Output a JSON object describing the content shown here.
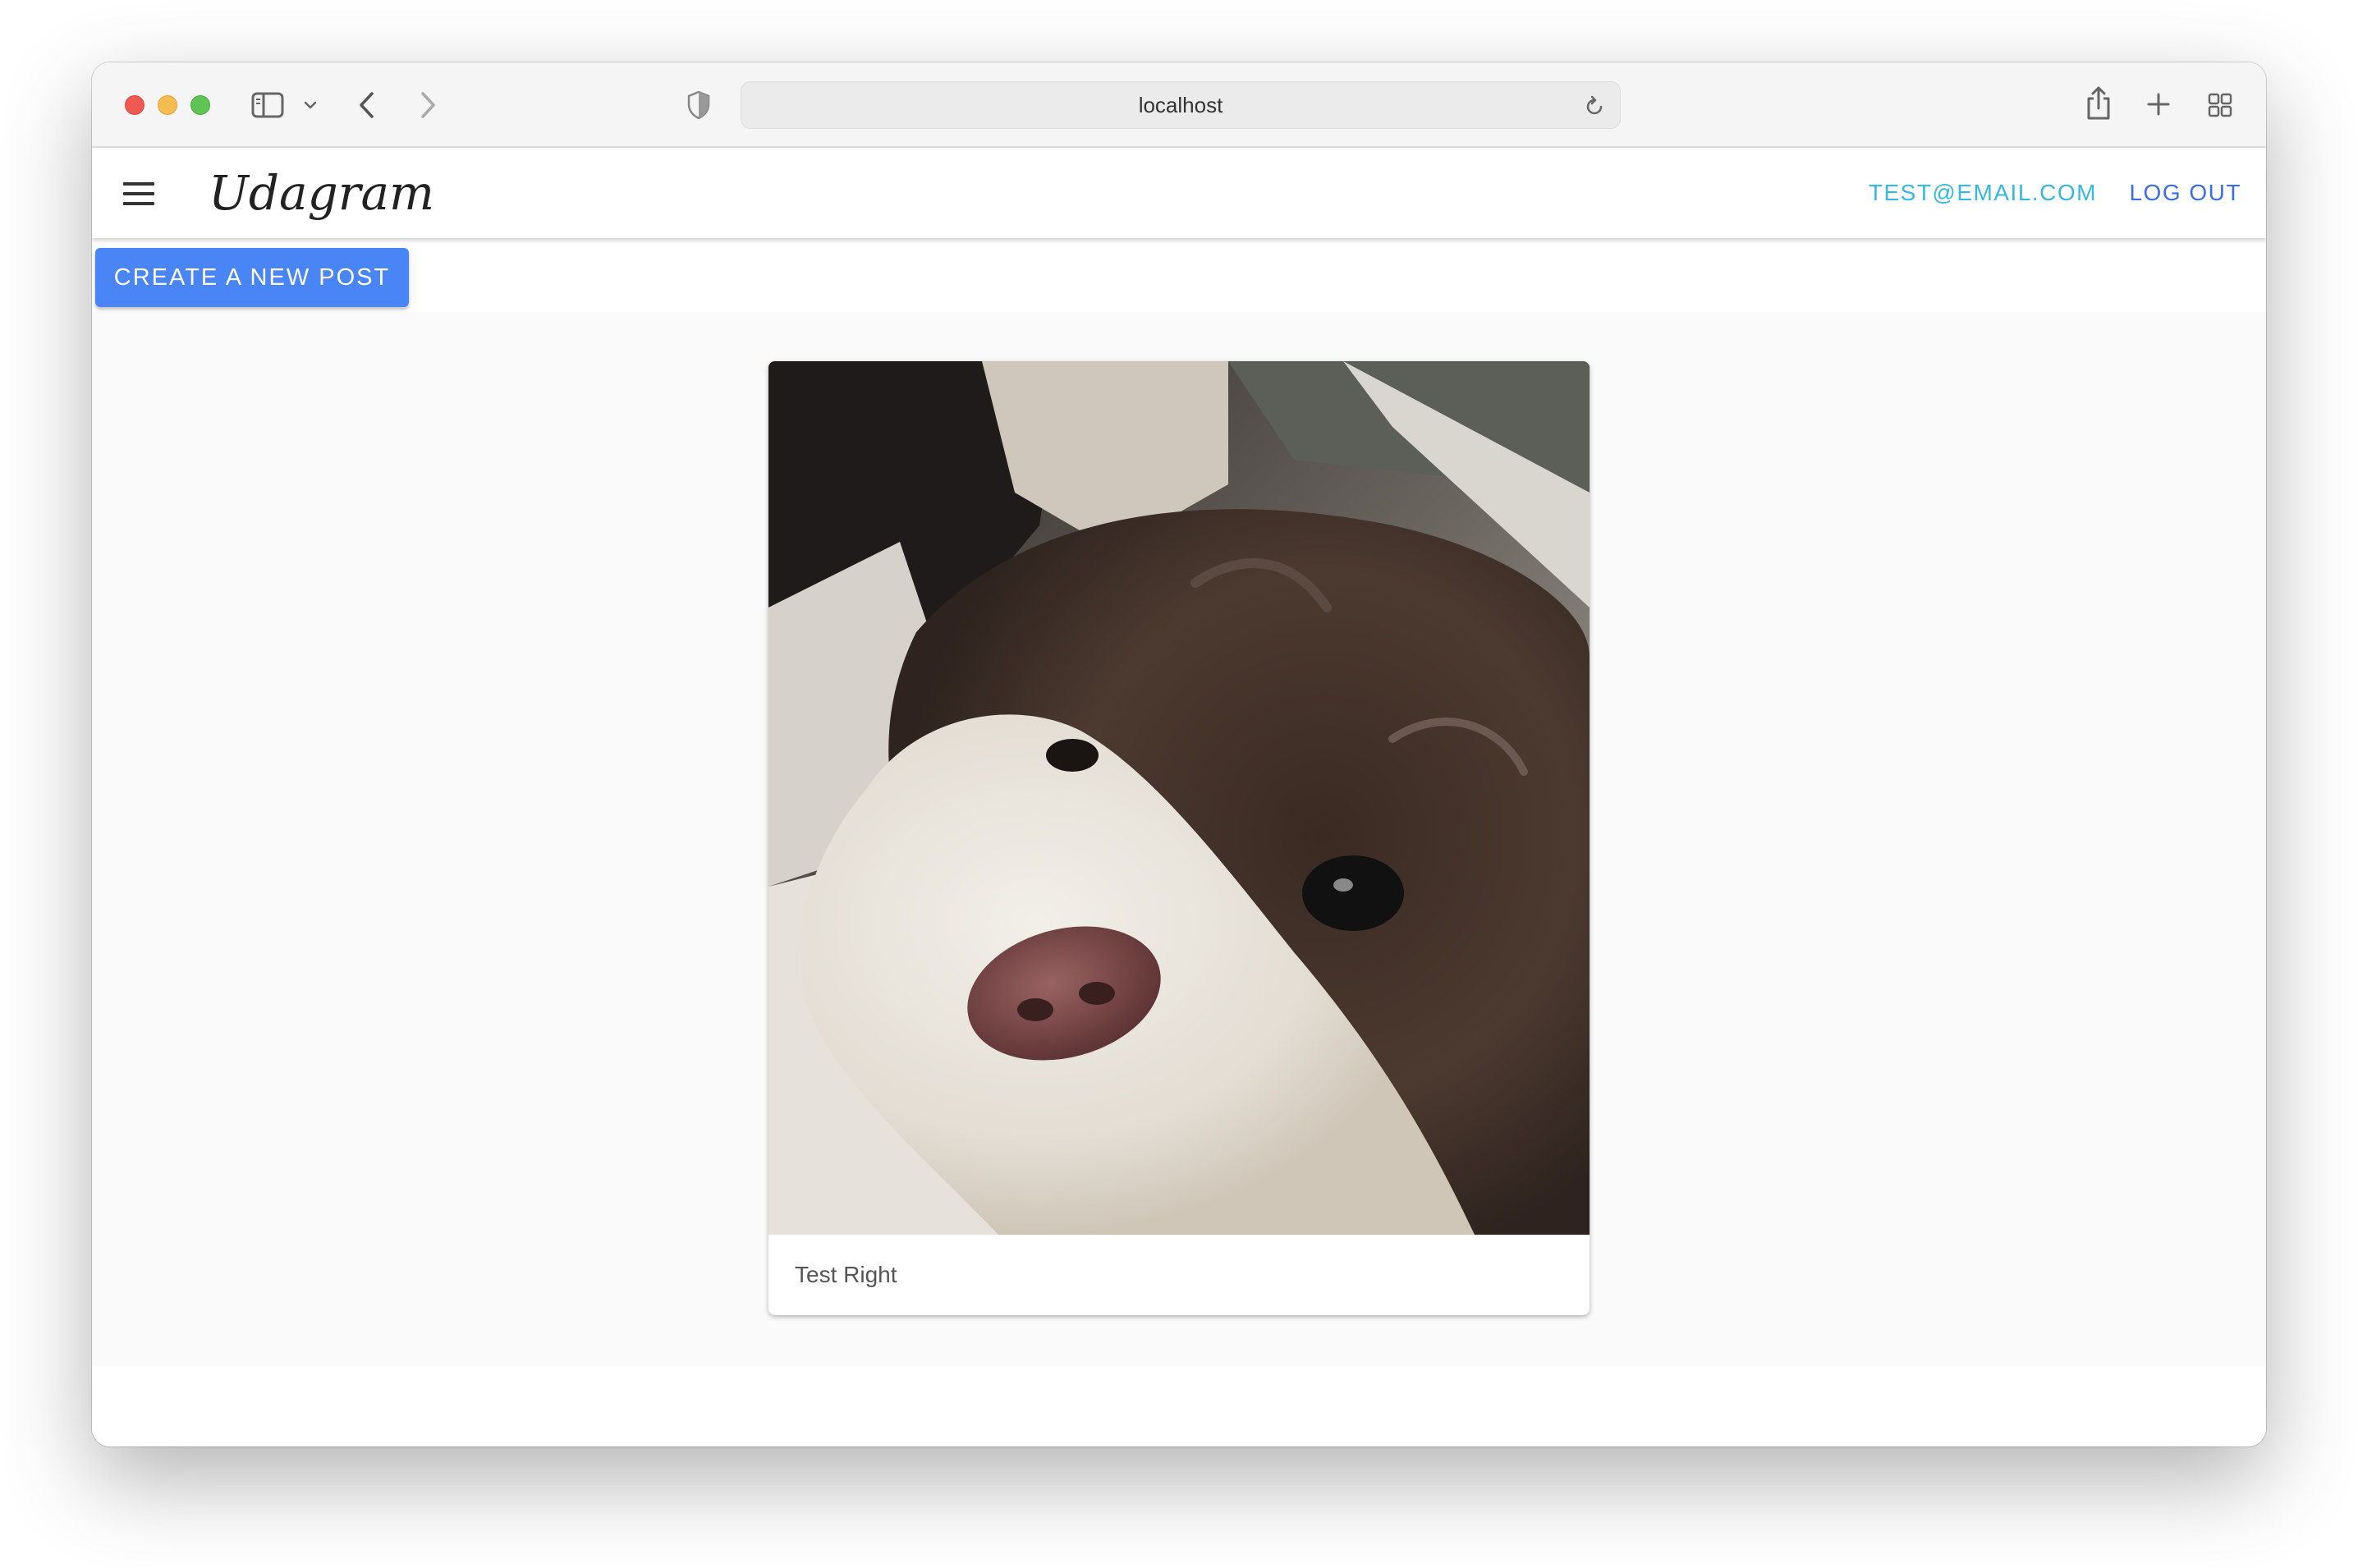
{
  "browser": {
    "url": "localhost",
    "icons": [
      "sidebar-icon",
      "chevron-down-icon",
      "back-icon",
      "forward-icon",
      "shield-icon",
      "reload-icon",
      "share-icon",
      "new-tab-icon",
      "tab-overview-icon"
    ]
  },
  "app": {
    "brand": "Udagram",
    "menu_icon": "menu-icon",
    "nav": {
      "email": "TEST@EMAIL.COM",
      "logout": "LOG OUT"
    },
    "create_button": "CREATE A NEW POST"
  },
  "feed": {
    "posts": [
      {
        "image": "dog-photo",
        "caption": "Test Right"
      }
    ]
  },
  "colors": {
    "primary": "#4a85f6",
    "email_link": "#37b8e0",
    "logout_link": "#3a6fe0",
    "feed_background": "#fafafa"
  }
}
